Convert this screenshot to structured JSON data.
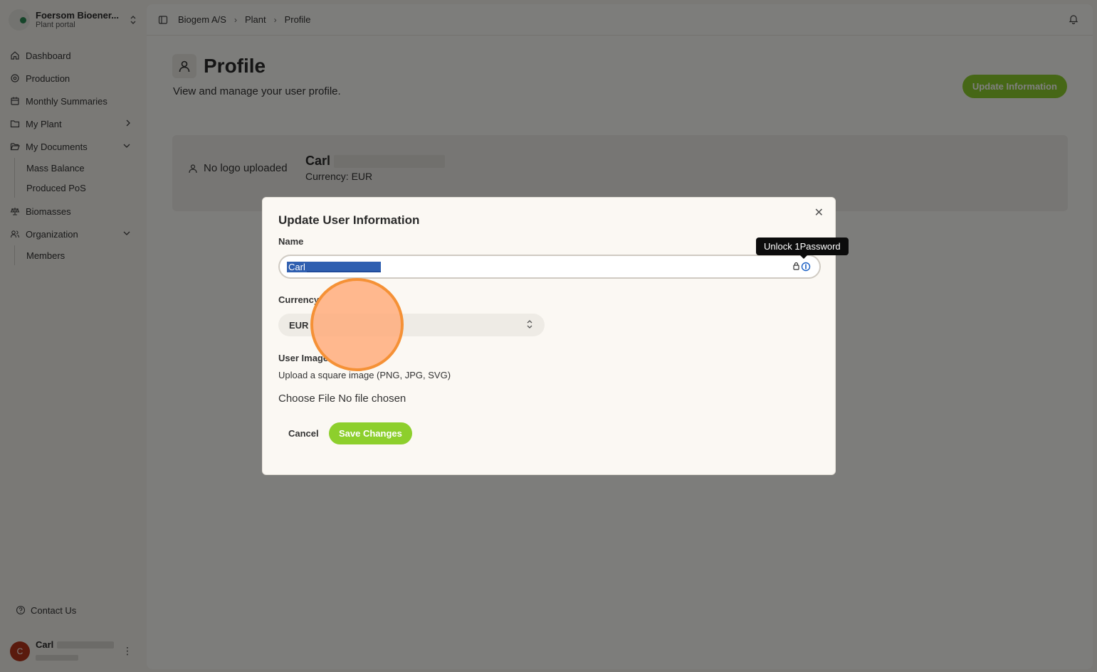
{
  "sidebar": {
    "org": {
      "name": "Foersom Bioener...",
      "subtitle": "Plant portal"
    },
    "nav": [
      {
        "label": "Dashboard",
        "icon": "home-icon"
      },
      {
        "label": "Production",
        "icon": "production-icon"
      },
      {
        "label": "Monthly Summaries",
        "icon": "calendar-icon"
      },
      {
        "label": "My Plant",
        "icon": "folder-icon"
      },
      {
        "label": "My Documents",
        "icon": "folder-open-icon"
      },
      {
        "label": "Biomasses",
        "icon": "scale-icon"
      },
      {
        "label": "Organization",
        "icon": "users-icon"
      }
    ],
    "documents_sub": [
      "Mass Balance",
      "Produced PoS"
    ],
    "organization_sub": [
      "Members"
    ],
    "contact": "Contact Us",
    "user": {
      "initial": "C",
      "name": "Carl"
    }
  },
  "breadcrumb": [
    "Biogem A/S",
    "Plant",
    "Profile"
  ],
  "page": {
    "title": "Profile",
    "description": "View and manage your user profile.",
    "update_button": "Update Information"
  },
  "profile_card": {
    "no_logo": "No logo uploaded",
    "name": "Carl",
    "currency": "Currency: EUR"
  },
  "modal": {
    "title": "Update User Information",
    "name_label": "Name",
    "name_value": "Carl",
    "tooltip": "Unlock 1Password",
    "currency_label": "Currency",
    "currency_value": "EUR",
    "image_label": "User Image",
    "image_hint": "Upload a square image (PNG, JPG, SVG)",
    "file_input": "Choose File No file chosen",
    "cancel": "Cancel",
    "save": "Save Changes"
  },
  "colors": {
    "accent": "#8dcf2c",
    "avatar": "#b5341b",
    "selection": "#2f5fb0"
  }
}
